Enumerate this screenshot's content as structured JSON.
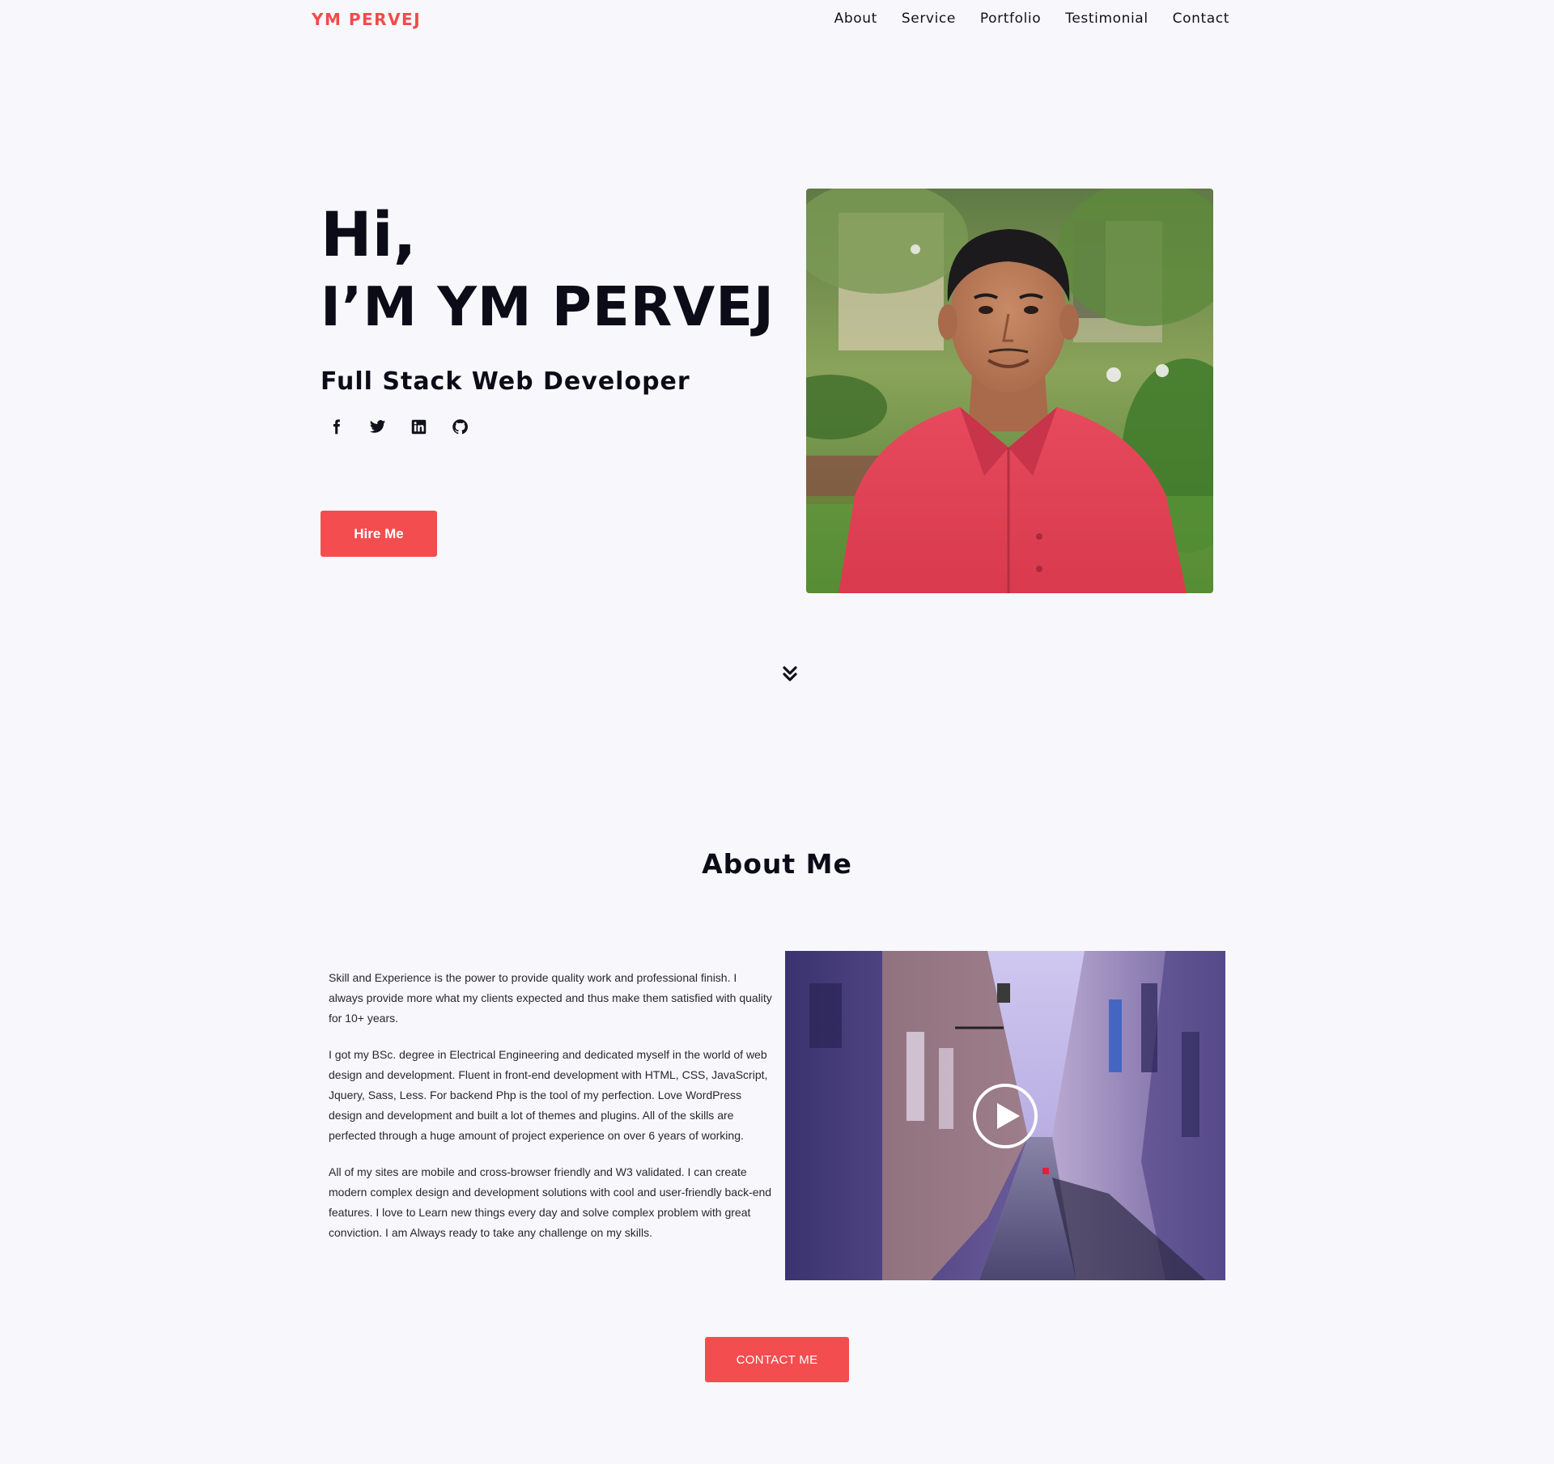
{
  "header": {
    "logo": "YM PERVEJ",
    "nav": [
      "About",
      "Service",
      "Portfolio",
      "Testimonial",
      "Contact"
    ]
  },
  "hero": {
    "greeting": "Hi,",
    "name": "I’M YM PERVEJ",
    "role": "Full Stack Web Developer",
    "social": [
      "facebook-icon",
      "twitter-icon",
      "linkedin-icon",
      "github-icon"
    ],
    "hire_label": "Hire Me"
  },
  "about": {
    "title": "About Me",
    "paragraphs": [
      "Skill and Experience is the power to provide quality work and professional finish. I always provide more what my clients expected and thus make them satisfied with quality for 10+ years.",
      "I got my BSc. degree in Electrical Engineering and dedicated myself in the world of web design and development. Fluent in front-end development with HTML, CSS, JavaScript, Jquery, Sass, Less. For backend Php is the tool of my perfection. Love WordPress design and development and built a lot of themes and plugins. All of the skills are perfected through a huge amount of project experience on over 6 years of working.",
      "All of my sites are mobile and cross-browser friendly and W3 validated. I can create modern complex design and development solutions with cool and user-friendly back-end features. I love to Learn new things every day and solve complex problem with great conviction. I am Always ready to take any challenge on my skills."
    ],
    "contact_label": "CONTACT ME"
  },
  "colors": {
    "accent": "#f44d4f",
    "background": "#f8f8fc",
    "text": "#0c0c18"
  }
}
